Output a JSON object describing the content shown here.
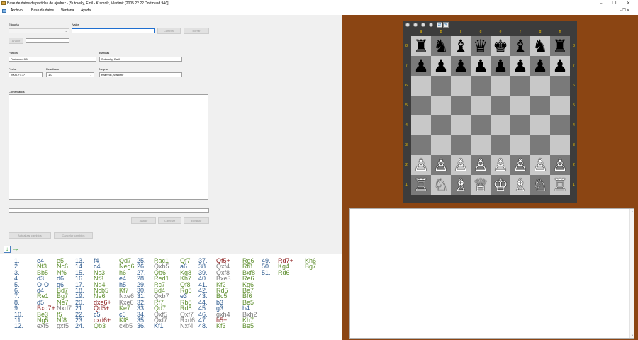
{
  "window": {
    "title": "Base de datos de partidas de ajedrez - [Sutovsky, Emil - Kramnik, Vladimir (2005.??.?? Dortmund 94/)]",
    "minimize": "–",
    "maximize": "❐",
    "close": "✕",
    "child_controls": "– ❐ ✕"
  },
  "menu": [
    "Archivo",
    "Base de datos",
    "Ventana",
    "Ayuda"
  ],
  "form": {
    "label_etiqueta": "Etiqueta",
    "label_valor": "Valor",
    "valor": "",
    "btn_cambiar": "Cambiar",
    "btn_borrar": "Borrar",
    "btn_anadir": "Añadir",
    "label_partida": "Partida",
    "partida": "Dortmund 94/",
    "label_blancas": "Blancas",
    "blancas": "Sutovsky, Emil",
    "label_fecha": "Fecha",
    "fecha": "2005.??.??",
    "label_resultado": "Resultado",
    "resultado": "1-0",
    "label_negras": "Negras",
    "negras": "Kramnik, Vladimir",
    "label_comentarios": "Comentarios",
    "btn_anadir2": "Añadir",
    "btn_cambiar2": "Cambiar",
    "btn_eliminar": "Eliminar",
    "btn_actualizar": "Actualizar cambios",
    "btn_cancelar": "Cancelar cambios"
  },
  "notation": {
    "numbers": [
      [
        "1.",
        "2.",
        "3.",
        "4.",
        "5.",
        "6.",
        "7.",
        "8.",
        "9.",
        "10.",
        "11.",
        "12."
      ],
      [
        "13.",
        "14.",
        "15.",
        "16.",
        "17.",
        "18.",
        "19.",
        "20.",
        "21.",
        "22.",
        "23.",
        "24."
      ],
      [
        "25.",
        "26.",
        "27.",
        "28.",
        "29.",
        "30.",
        "31.",
        "32.",
        "33.",
        "34.",
        "35.",
        "36."
      ],
      [
        "37.",
        "38.",
        "39.",
        "40.",
        "41.",
        "42.",
        "43.",
        "44.",
        "45.",
        "46.",
        "47.",
        "48."
      ],
      [
        "49.",
        "50.",
        "51."
      ]
    ],
    "white": [
      [
        "e4",
        "Nf3",
        "Bb5",
        "d3",
        "O-O",
        "d4",
        "Re1",
        "d5",
        "Bxd7+",
        "Be3",
        "Ng5",
        "exf5"
      ],
      [
        "f4",
        "c4",
        "Nc3",
        "Nf3",
        "Nd4",
        "Ncb5",
        "Ne6",
        "dxe6+",
        "Qd5+",
        "c5",
        "cxd6+",
        "Qb3"
      ],
      [
        "Rac1",
        "Qxb5",
        "Qb6",
        "Red1",
        "Rc7",
        "Bd4",
        "Qxb7",
        "Rf7",
        "Qd7",
        "Qxf5",
        "Qxf7",
        "Kf1"
      ],
      [
        "Qf5+",
        "Qxf4",
        "Qxf8",
        "Bxe3",
        "Kf2",
        "Rd5",
        "Bc5",
        "b3",
        "g3",
        "gxh4",
        "h5+",
        "Kf3"
      ],
      [
        "Rd7+",
        "Kg4",
        "Rd6"
      ]
    ],
    "black": [
      [
        "e5",
        "Nc6",
        "Nf6",
        "d6",
        "g6",
        "Bd7",
        "Bg7",
        "Ne7",
        "Nxd7",
        "f5",
        "Nf8",
        "gxf5"
      ],
      [
        "Qd7",
        "Neg6",
        "h6",
        "e4",
        "h5",
        "Kf7",
        "Nxe6",
        "Kxe6",
        "Ke7",
        "c6",
        "Kf8",
        "cxb5"
      ],
      [
        "Qf7",
        "a6",
        "Kg8",
        "Kh7",
        "Qf8",
        "Rg8",
        "e3",
        "Rb8",
        "Rd8",
        "Qxf7",
        "Rxd6",
        "Nxf4"
      ],
      [
        "Rg6",
        "Rf8",
        "Bxf8",
        "Re6",
        "Kg6",
        "Be7",
        "Bf6",
        "Be5",
        "h4",
        "Bxh2",
        "Kh7",
        "Be5"
      ],
      [
        "Kh6",
        "Bg7"
      ]
    ],
    "white_colors": [
      [
        "#2d5a8e",
        "#5f8f2f",
        "#5f8f2f",
        "#2d5a8e",
        "#2d5a8e",
        "#2d5a8e",
        "#5f8f2f",
        "#2d5a8e",
        "#8b1a1a",
        "#5f8f2f",
        "#5f8f2f",
        "#7a7a7a"
      ],
      [
        "#2d5a8e",
        "#2d5a8e",
        "#5f8f2f",
        "#5f8f2f",
        "#5f8f2f",
        "#5f8f2f",
        "#5f8f2f",
        "#8b1a1a",
        "#8b1a1a",
        "#2d5a8e",
        "#8b1a1a",
        "#5f8f2f"
      ],
      [
        "#5f8f2f",
        "#7a7a7a",
        "#5f8f2f",
        "#5f8f2f",
        "#5f8f2f",
        "#5f8f2f",
        "#7a7a7a",
        "#5f8f2f",
        "#5f8f2f",
        "#7a7a7a",
        "#7a7a7a",
        "#2d5a8e"
      ],
      [
        "#8b1a1a",
        "#7a7a7a",
        "#7a7a7a",
        "#7a7a7a",
        "#5f8f2f",
        "#5f8f2f",
        "#5f8f2f",
        "#2d5a8e",
        "#2d5a8e",
        "#7a7a7a",
        "#8b1a1a",
        "#5f8f2f"
      ],
      [
        "#8b1a1a",
        "#5f8f2f",
        "#5f8f2f"
      ]
    ],
    "black_colors": [
      [
        "#5f8f2f",
        "#5f8f2f",
        "#5f8f2f",
        "#2d5a8e",
        "#2d5a8e",
        "#5f8f2f",
        "#5f8f2f",
        "#5f8f2f",
        "#7a7a7a",
        "#5f8f2f",
        "#5f8f2f",
        "#7a7a7a"
      ],
      [
        "#5f8f2f",
        "#5f8f2f",
        "#5f8f2f",
        "#2d5a8e",
        "#2d5a8e",
        "#5f8f2f",
        "#7a7a7a",
        "#7a7a7a",
        "#5f8f2f",
        "#2d5a8e",
        "#5f8f2f",
        "#7a7a7a"
      ],
      [
        "#5f8f2f",
        "#2d5a8e",
        "#5f8f2f",
        "#5f8f2f",
        "#5f8f2f",
        "#5f8f2f",
        "#2d5a8e",
        "#5f8f2f",
        "#5f8f2f",
        "#7a7a7a",
        "#7a7a7a",
        "#7a7a7a"
      ],
      [
        "#5f8f2f",
        "#5f8f2f",
        "#5f8f2f",
        "#5f8f2f",
        "#5f8f2f",
        "#5f8f2f",
        "#5f8f2f",
        "#5f8f2f",
        "#2d5a8e",
        "#7a7a7a",
        "#5f8f2f",
        "#5f8f2f"
      ],
      [
        "#5f8f2f",
        "#5f8f2f"
      ]
    ]
  },
  "board": {
    "files": [
      "a",
      "b",
      "c",
      "d",
      "e",
      "f",
      "g",
      "h"
    ],
    "ranks": [
      "8",
      "7",
      "6",
      "5",
      "4",
      "3",
      "2",
      "1"
    ],
    "position": [
      [
        "♜",
        "♞",
        "♝",
        "♛",
        "♚",
        "♝",
        "♞",
        "♜"
      ],
      [
        "♟",
        "♟",
        "♟",
        "♟",
        "♟",
        "♟",
        "♟",
        "♟"
      ],
      [
        "",
        "",
        "",
        "",
        "",
        "",
        "",
        ""
      ],
      [
        "",
        "",
        "",
        "",
        "",
        "",
        "",
        ""
      ],
      [
        "",
        "",
        "",
        "",
        "",
        "",
        "",
        ""
      ],
      [
        "",
        "",
        "",
        "",
        "",
        "",
        "",
        ""
      ],
      [
        "♙",
        "♙",
        "♙",
        "♙",
        "♙",
        "♙",
        "♙",
        "♙"
      ],
      [
        "♖",
        "♘",
        "♗",
        "♕",
        "♔",
        "♗",
        "♘",
        "♖"
      ]
    ]
  },
  "colors": {
    "board_background": "#8b4513",
    "light_square": "#c8c8c8",
    "dark_square": "#7a7a7a",
    "coordinate_text": "#f0c000"
  },
  "icons": {
    "app": "chess-board-icon",
    "move_down": "↓",
    "move_right": "→",
    "swap": "⇄",
    "edit": "✎"
  }
}
